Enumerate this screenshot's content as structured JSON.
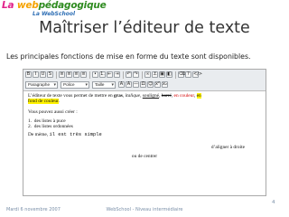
{
  "logo": {
    "part1": "La ",
    "part2": "web",
    "part3": "pédagogique",
    "sub": "La WebSchool"
  },
  "title": "Maîtriser l’éditeur de texte",
  "subtitle": "Les principales fonctions de mise en forme du texte sont disponibles.",
  "editor": {
    "toolbar": {
      "row1": [
        "B",
        "I",
        "U",
        "S",
        "≡",
        "≡",
        "≡",
        "≡",
        "•",
        "1.",
        "⇤",
        "⇥",
        "↶",
        "↷",
        "∞",
        "⚓",
        "▣",
        "◧",
        "⌫",
        "?",
        "</>"
      ],
      "format_select": "Paragraphe",
      "font_select": "Police",
      "size_select": "Taille",
      "row2_buttons": [
        "A",
        "A",
        "—",
        "Ω",
        "☺",
        "x²",
        "x₂"
      ]
    },
    "content": {
      "line1_a": "L’éditeur de texte vous permet de mettre en ",
      "line1_bold": "gras",
      "line1_b": ", ",
      "line1_italic": "italique",
      "line1_c": ", ",
      "line1_ul": "souligné",
      "line1_d": ", ",
      "line1_strike": "barré",
      "line1_e": ", ",
      "line1_red": "en couleur",
      "line1_f": ", ",
      "line1_g": "en",
      "line2_hl": "fond de couleur",
      "line2_end": ".",
      "heading_list": "Vous pouvez aussi créer :",
      "list_items": [
        "des listes à puce",
        "des listes ordonnées"
      ],
      "line_style_a": "De mème, ",
      "line_style_b": "il est très simple",
      "right_text": "d’aligner à droite",
      "center_text": "ou de centrer"
    }
  },
  "footer": {
    "date": "Mardi 6 novembre 2007",
    "center": "WebSchool - Niveau intermédiaire",
    "page": "4"
  }
}
